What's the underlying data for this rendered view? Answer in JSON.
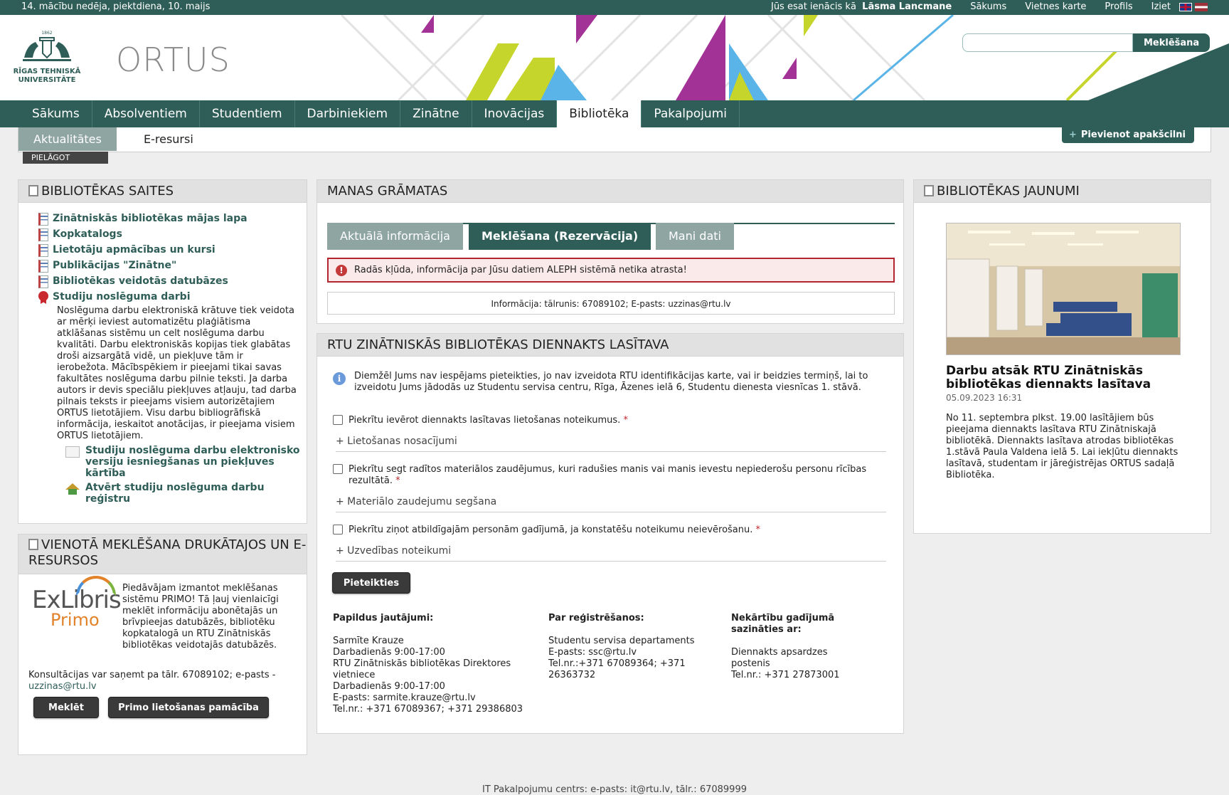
{
  "topbar": {
    "week": "14. mācību nedēja, piektdiena, 10. maijs",
    "logged_prefix": "Jūs esat ienācis kā",
    "user": "Lāsma Lancmane",
    "links": [
      "Sākums",
      "Vietnes karte",
      "Profils",
      "Iziet"
    ]
  },
  "header": {
    "university": "RĪGAS TEHNISKĀ UNIVERSITĀTE",
    "year": "1862",
    "portal": "ORTUS",
    "search_button": "Meklēšana",
    "search_placeholder": ""
  },
  "nav": [
    "Sākums",
    "Absolventiem",
    "Studentiem",
    "Darbiniekiem",
    "Zinātne",
    "Inovācijas",
    "Bibliotēka",
    "Pakalpojumi"
  ],
  "subnav": {
    "active": "Aktualitātes",
    "other": "E-resursi",
    "add": "Pievienot apakšcilni",
    "customize": "PIELĀGOT"
  },
  "links_panel": {
    "title": "BIBLIOTĒKAS SAITES",
    "items": [
      "Zinātniskās bibliotēkas mājas lapa",
      "Kopkatalogs",
      "Lietotāju apmācības un kursi",
      "Publikācijas \"Zinātne\"",
      "Bibliotēkas veidotās datubāzes",
      "Studiju noslēguma darbi"
    ],
    "description": "Noslēguma darbu elektroniskā krātuve tiek veidota ar mērķi ieviest automatizētu plaģiātisma atklāšanas sistēmu un celt noslēguma darbu kvalitāti. Darbu elektroniskās kopijas tiek glabātas droši aizsargātā vidē, un piekļuve tām ir ierobežota. Mācībspēkiem ir pieejami tikai savas fakultātes noslēguma darbu pilnie teksti. Ja darba autors ir devis speciālu piekļuves atļauju, tad darba pilnais teksts ir pieejams visiem autorizētajiem ORTUS lietotājiem. Visu darbu bibliogrāfiskā informācija, ieskaitot anotācijas, ir pieejama visiem ORTUS lietotājiem.",
    "sub_items": [
      "Studiju noslēguma darbu elektronisko versiju iesniegšanas un piekļuves kārtība",
      "Atvērt studiju noslēguma darbu reģistru"
    ]
  },
  "primo_panel": {
    "title": "VIENOTĀ MEKLĒŠANA DRUKĀTAJOS UN E-RESURSOS",
    "logo_exl": "ExLibris",
    "logo_primo": "Primo",
    "text": "Piedāvājam izmantot meklēšanas sistēmu PRIMO! Tā ļauj vienlaicīgi meklēt informāciju abonētajās un brīvpieejas datubāzēs, bibliotēku kopkatalogā un RTU Zinātniskās bibliotēkas veidotajās datubāzēs.",
    "consult": "Konsultācijas var saņemt pa tālr. 67089102; e-pasts -",
    "email": "uzzinas@rtu.lv",
    "btn_search": "Meklēt",
    "btn_guide": "Primo lietošanas pamācība"
  },
  "books_panel": {
    "title": "MANAS GRĀMATAS",
    "tabs": [
      "Aktuālā informācija",
      "Meklēšana (Rezervācija)",
      "Mani dati"
    ],
    "error": "Radās kļūda, informācija par Jūsu datiem ALEPH sistēmā netika atrasta!",
    "info": "Informācija: tālrunis: 67089102; E-pasts: uzzinas@rtu.lv"
  },
  "room_panel": {
    "title": "RTU ZINĀTNISKĀS BIBLIOTĒKAS DIENNAKTS LASĪTAVA",
    "notice": "Diemžēl Jums nav iespējams pieteikties, jo nav izveidota RTU identifikācijas karte, vai ir beidzies termiņš, lai to izveidotu Jums jādodās uz Studentu servisa centru, Rīga, Āzenes ielā 6, Studentu dienesta viesnīcas 1. stāvā.",
    "check1": "Piekrītu ievērot diennakts lasītavas lietošanas noteikumus.",
    "exp1": "+ Lietošanas nosacījumi",
    "check2": "Piekrītu segt radītos materiālos zaudējumus, kuri radušies manis vai manis ievestu nepiederošu personu rīcības rezultātā.",
    "exp2": "+ Materiālo zaudejumu segšana",
    "check3": "Piekrītu ziņot atbildīgajām personām gadījumā, ja konstatēšu noteikumu neievērošanu.",
    "exp3": "+ Uzvedības noteikumi",
    "required_mark": "*",
    "submit": "Pieteikties",
    "contact1": {
      "title": "Papildus jautājumi:",
      "lines": [
        "Sarmīte Krauze",
        "Darbadienās 9:00-17:00",
        "RTU Zinātniskās bibliotēkas Direktores vietniece",
        "Darbadienās 9:00-17:00",
        "E-pasts: sarmite.krauze@rtu.lv",
        "Tel.nr.: +371 67089367; +371 29386803"
      ]
    },
    "contact2": {
      "title": "Par reģistrēšanos:",
      "lines": [
        "Studentu servisa departaments",
        "E-pasts: ssc@rtu.lv",
        "Tel.nr.:+371 67089364; +371 26363732"
      ]
    },
    "contact3": {
      "title": "Nekārtību gadījumā sazināties ar:",
      "lines": [
        "Diennakts apsardzes postenis",
        "Tel.nr.: +371 27873001"
      ]
    }
  },
  "news_panel": {
    "title": "BIBLIOTĒKAS JAUNUMI",
    "headline": "Darbu atsāk RTU Zinātniskās bibliotēkas diennakts lasītava",
    "date": "05.09.2023 16:31",
    "text": "No 11. septembra plkst. 19.00 lasītājiem būs pieejama diennakts lasītava RTU Zinātniskajā bibliotēkā. Diennakts lasītava atrodas bibliotēkas 1.stāvā Paula Valdena ielā 5. Lai iekļūtu diennakts lasītavā, studentam ir jāreģistrējas ORTUS sadaļā Bibliotēka."
  },
  "footer": "IT Pakalpojumu centrs: e-pasts: it@rtu.lv, tālr.: 67089999",
  "colors": {
    "brand": "#2f5e58",
    "tab_inactive": "#8fa5a2",
    "error": "#b32630"
  }
}
